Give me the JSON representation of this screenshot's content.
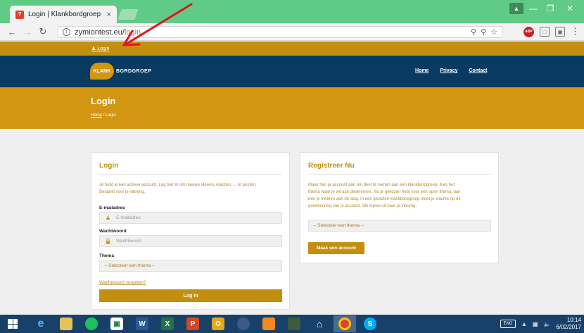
{
  "browser": {
    "tab_title": "Login | Klankbordgroep",
    "tab_close": "×",
    "url_host": "zymiontest.eu/",
    "url_path": "login",
    "abp_label": "ABP"
  },
  "site": {
    "topbar_login": "Login",
    "logo_bubble": "KLANK",
    "logo_text": "BORDGROEP",
    "nav": [
      "Home",
      "Privacy",
      "Contact"
    ],
    "page_title": "Login",
    "breadcrumb_home": "Home",
    "breadcrumb_sep": "/",
    "breadcrumb_current": "Login",
    "colors": {
      "gold": "#d29610",
      "navy": "#083a62"
    }
  },
  "login_card": {
    "title": "Login",
    "intro_line1": "Je hebt al een actieve account. Log hier in om nieuwe ideeën, reacties, ... te posten.",
    "intro_line2": "Bedankt voor je inbreng.",
    "email_label": "E-mailadres",
    "email_placeholder": "E-mailadres",
    "password_label": "Wachtwoord",
    "password_placeholder": "Wachtwoord",
    "theme_label": "Thema",
    "theme_select": "-- Selecteer een thema --",
    "forgot_link": "Wachtwoord vergeten?",
    "submit": "Log in"
  },
  "register_card": {
    "title": "Registreer Nu",
    "text_lines": [
      "Maak hier je account aan om deel te nemen aan een klankbordgroep. Kies het",
      "thema waar je wil aan deelnemen. Als je gekozen hebt voor een open thema, dan",
      "ben je meteen aan de slag. In een gesloten klankbordgroep moet je wachte op de",
      "goedkeuring van je account. We kijken uit naar je inbreng."
    ],
    "theme_select": "-- Selecteer een thema --",
    "submit": "Maak een account"
  },
  "taskbar": {
    "time": "10:14",
    "date": "6/02/2017",
    "kbd": "ENG"
  }
}
